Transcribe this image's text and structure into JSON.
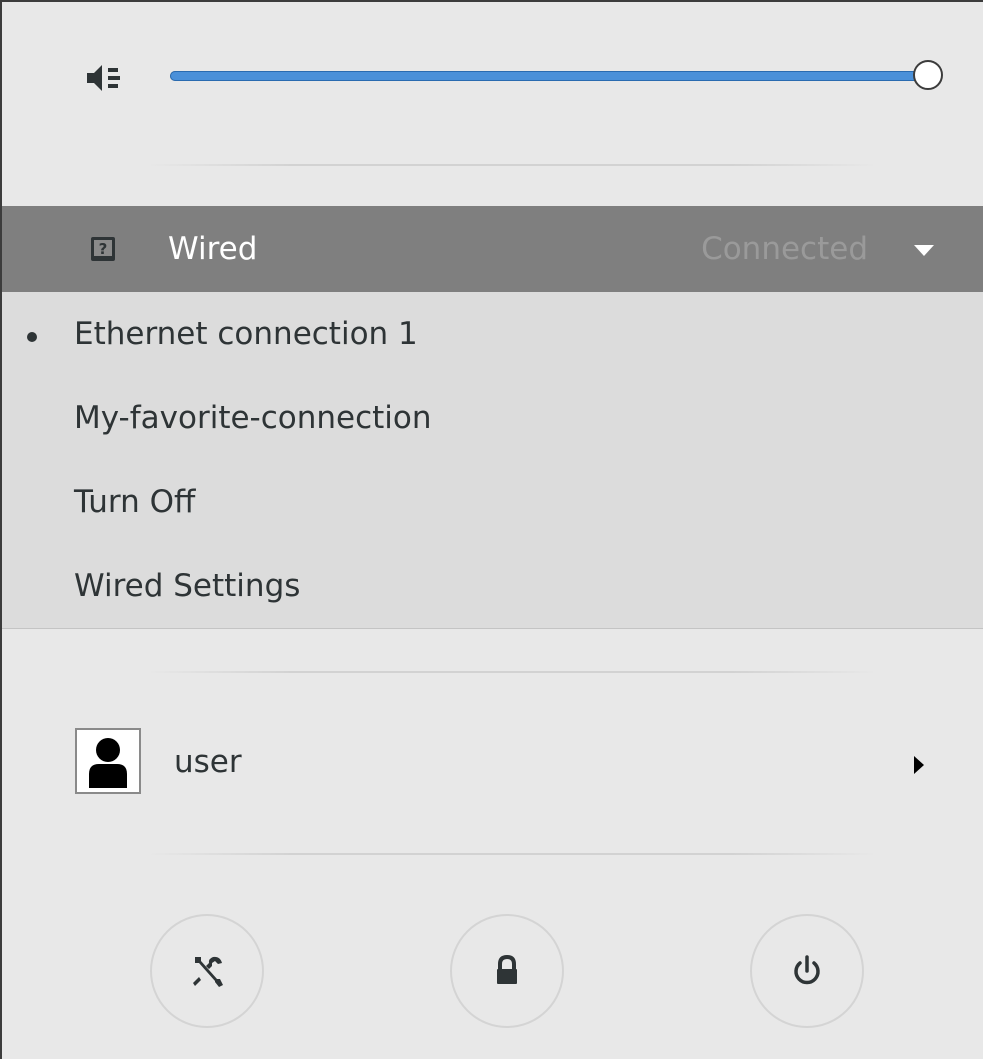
{
  "volume": {
    "icon": "speaker-volume-icon",
    "level": 1.0,
    "accent_color": "#4a90d9"
  },
  "network": {
    "icon": "network-unknown-icon",
    "label": "Wired",
    "status": "Connected",
    "items": [
      {
        "label": "Ethernet connection 1",
        "active": true
      },
      {
        "label": "My-favorite-connection",
        "active": false
      },
      {
        "label": "Turn Off",
        "active": false
      },
      {
        "label": "Wired Settings",
        "active": false
      }
    ]
  },
  "user": {
    "name": "user",
    "icon": "avatar-icon"
  },
  "actions": {
    "settings_icon": "settings-tools-icon",
    "lock_icon": "lock-icon",
    "power_icon": "power-icon"
  }
}
